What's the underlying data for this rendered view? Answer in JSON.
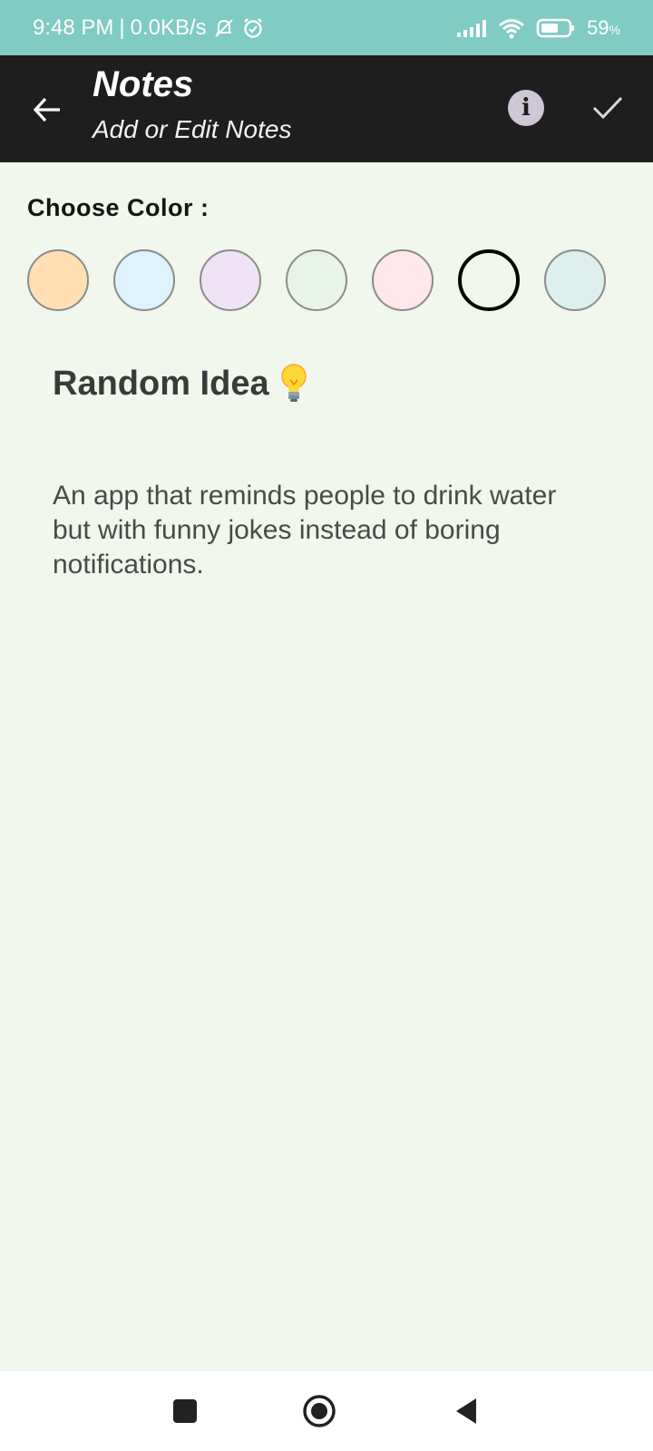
{
  "status_bar": {
    "time": "9:48 PM",
    "network_speed": "0.0KB/s",
    "icons": [
      "mute-icon",
      "alarm-icon",
      "signal-icon",
      "wifi-icon",
      "battery-icon"
    ],
    "battery_percent": "59",
    "battery_unit": "%",
    "color": "#80cbc4"
  },
  "toolbar": {
    "title": "Notes",
    "subtitle": "Add or Edit Notes",
    "back_icon": "arrow-left-icon",
    "info_icon": "info-icon",
    "check_icon": "check-icon",
    "info_glyph": "i"
  },
  "color_picker": {
    "label": "Choose Color :",
    "swatches": [
      "#ffdfb3",
      "#dff3ff",
      "#f1e3f6",
      "#e9f4e9",
      "#ffe7ec",
      "#f1f7ec",
      "#ddf0ee"
    ],
    "selected_index": 5
  },
  "note": {
    "title": "Random Idea",
    "title_icon": "lightbulb-icon",
    "body": "An app that reminds people to drink water but with funny jokes instead of boring notifications."
  },
  "nav_bar": {
    "icons": [
      "recents-square-icon",
      "home-circle-icon",
      "back-triangle-icon"
    ]
  }
}
